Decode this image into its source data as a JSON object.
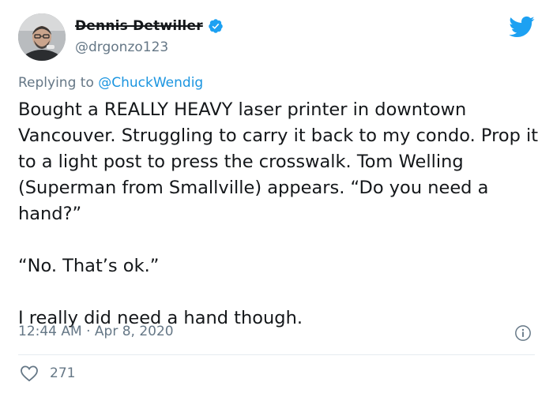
{
  "user": {
    "display_name": "Dennis Detwiller",
    "handle": "@drgonzo123",
    "avatar_icon": "avatar-photo",
    "verified_icon": "verified-badge-icon"
  },
  "brand": {
    "logo_icon": "twitter-bird-icon",
    "accent_color": "#1da1f2"
  },
  "reply": {
    "prefix": "Replying to",
    "mention": "@ChuckWendig"
  },
  "tweet": {
    "paragraphs": [
      "Bought a REALLY HEAVY laser printer in downtown Vancouver. Struggling to carry it back to my condo. Prop it to a light post to press the crosswalk. Tom Welling (Superman from Smallville) appears. “Do you need a hand?”",
      "“No. That’s ok.”",
      "I really did need a hand though."
    ],
    "time": "12:44 AM",
    "date": "Apr 8, 2020",
    "separator": "·"
  },
  "actions": {
    "like_icon": "heart-icon",
    "like_count": "271",
    "info_icon": "info-icon"
  }
}
